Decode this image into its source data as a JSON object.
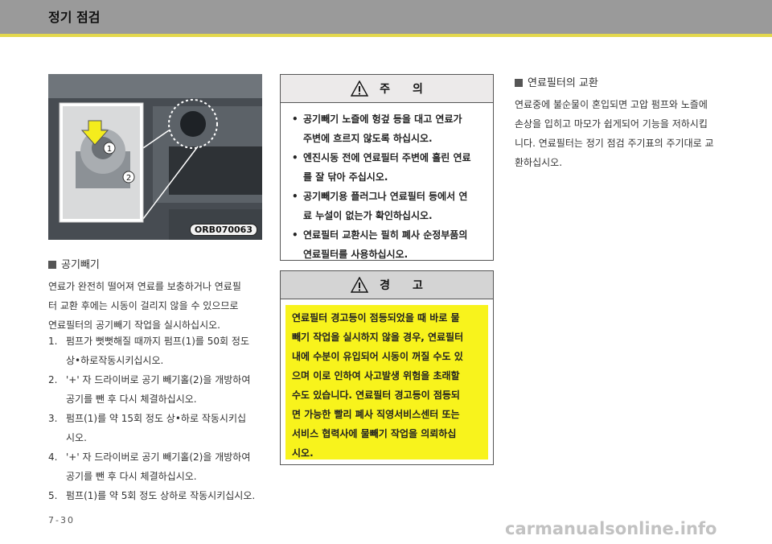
{
  "header": {
    "title": "정기 점검"
  },
  "photo": {
    "code": "ORB070063",
    "label_1": "1",
    "label_2": "2"
  },
  "air_vent": {
    "title": "공기빼기",
    "intro": [
      "연료가 완전히 떨어져 연료를 보충하거나 연료필",
      "터 교환 후에는 시동이 걸리지 않을 수 있으므로",
      "연료필터의 공기빼기 작업을 실시하십시오."
    ],
    "steps": [
      {
        "num": "1.",
        "lines": [
          "펌프가 뻣뻣해질 때까지 펌프(1)를 50회 정도",
          "상•하로작동시키십시오."
        ]
      },
      {
        "num": "2.",
        "lines": [
          "'+' 자 드라이버로 공기 빼기홀(2)을 개방하여",
          "공기를 뺀 후 다시 체결하십시오."
        ]
      },
      {
        "num": "3.",
        "lines": [
          "펌프(1)를 약 15회 정도 상•하로 작동시키십",
          "시오."
        ]
      },
      {
        "num": "4.",
        "lines": [
          "'+' 자 드라이버로 공기 빼기홀(2)을 개방하여",
          "공기를 뺀 후 다시 체결하십시오."
        ]
      },
      {
        "num": "5.",
        "lines": [
          "펌프(1)를 약 5회 정도 상하로 작동시키십시오."
        ]
      }
    ]
  },
  "caution": {
    "icon": "warning-triangle-icon",
    "title": "주　　의",
    "items": [
      [
        "공기빼기 노즐에 헝겊 등을 대고 연료가",
        "주변에 흐르지 않도록 하십시오."
      ],
      [
        "엔진시동 전에 연료필터 주변에 흘린 연료",
        "를 잘 닦아 주십시오."
      ],
      [
        "공기빼기용 플러그나 연료필터 등에서 연",
        "료 누설이 없는가 확인하십시오."
      ],
      [
        "연료필터 교환시는 필히 폐사 순정부품의",
        "연료필터를 사용하십시오."
      ]
    ]
  },
  "warning": {
    "icon": "warning-triangle-icon",
    "title": "경　　고",
    "lines": [
      "연료필터 경고등이 점등되었을 때 바로 물",
      "빼기 작업을 실시하지 않을 경우, 연료필터",
      "내에 수분이 유입되어 시동이 꺼질 수도 있",
      "으며 이로 인하여 사고발생 위험을 초래할",
      "수도 있습니다. 연료필터 경고등이 점등되",
      "면 가능한 빨리 폐사 직영서비스센터 또는",
      "서비스 협력사에 물빼기 작업을 의뢰하십",
      "시오."
    ]
  },
  "filter_replace": {
    "title": "연료필터의 교환",
    "lines": [
      "연료중에 불순물이 혼입되면 고압 펌프와 노즐에",
      "손상을 입히고 마모가 쉽게되어 기능을 저하시킵",
      "니다. 연료필터는 정기 점검 주기표의 주기대로 교",
      "환하십시오."
    ]
  },
  "footer": {
    "page": "7-30",
    "watermark": "carmanualsonline.info"
  },
  "colors": {
    "header": "#9a9a9a",
    "header_rule": "#e3d84d",
    "warning_fill": "#f8f31c"
  }
}
